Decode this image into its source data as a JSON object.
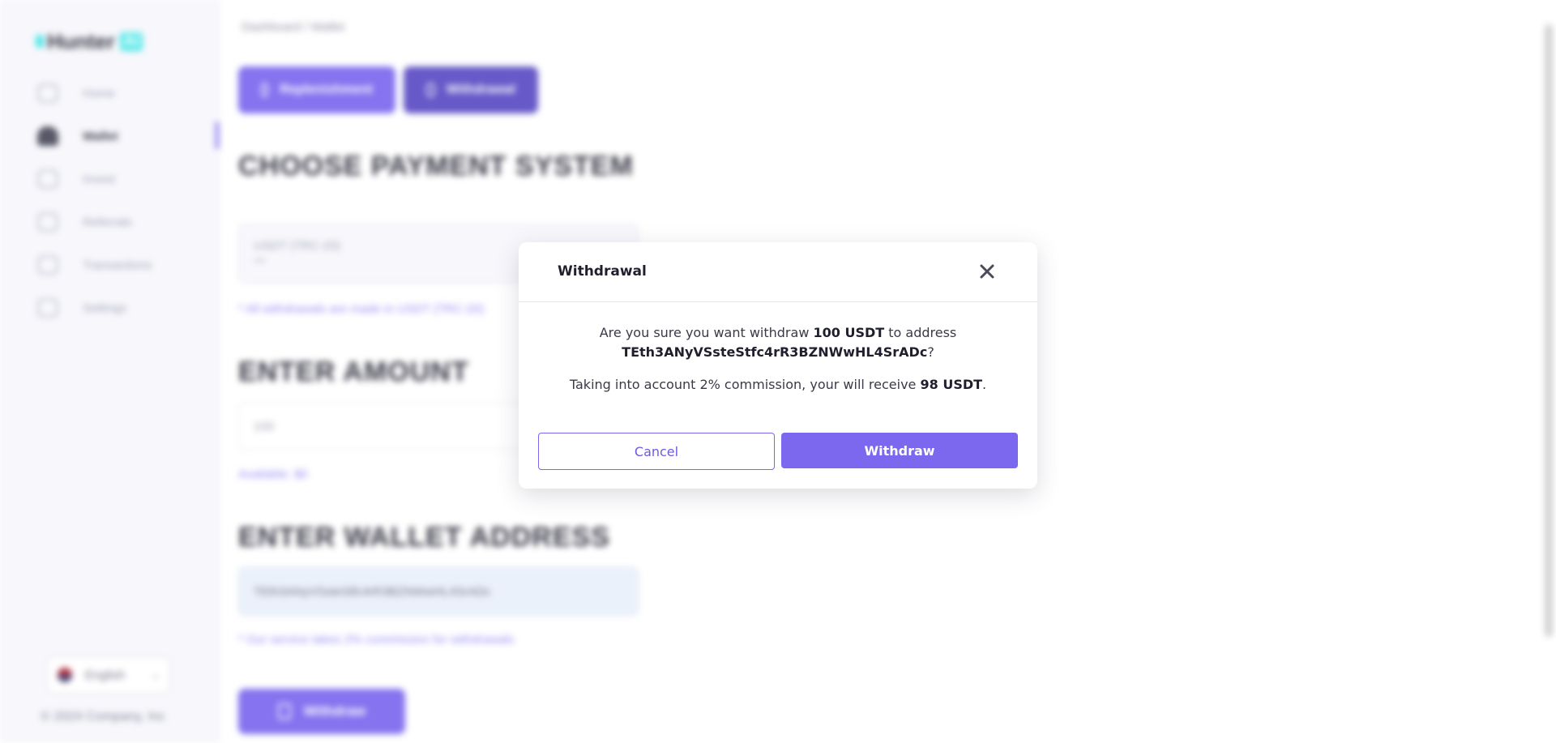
{
  "sidebar": {
    "logo": "Hunter",
    "logo_badge": "AI",
    "items": [
      {
        "label": "Home",
        "icon": "home-icon"
      },
      {
        "label": "Wallet",
        "icon": "wallet-icon"
      },
      {
        "label": "Invest",
        "icon": "invest-icon"
      },
      {
        "label": "Referrals",
        "icon": "referrals-icon"
      },
      {
        "label": "Transactions",
        "icon": "transactions-icon"
      },
      {
        "label": "Settings",
        "icon": "settings-icon"
      }
    ],
    "active_item": "Wallet",
    "language": "English",
    "copyright": "© 2024 Company, Inc"
  },
  "main": {
    "breadcrumb": "Dashboard / Wallet",
    "tabs": [
      {
        "label": "Replenishment"
      },
      {
        "label": "Withdrawal"
      }
    ],
    "payment_title": "CHOOSE PAYMENT SYSTEM",
    "payment_selected": "USDT (TRC-20)",
    "payment_sub": "***",
    "payment_hint": "* All withdrawals are made in USDT (TRC-20)",
    "amount_title": "ENTER AMOUNT",
    "amount_value": "100",
    "available_label": "Available:",
    "available_value": "$0",
    "wallet_title": "ENTER WALLET ADDRESS",
    "wallet_value": "TEth3ANyVSsteStfc4rR3BZNWwHL4SrADc",
    "commission_hint": "* Our service takes 2% commission for withdrawals",
    "withdraw_button": "Withdraw"
  },
  "modal": {
    "title": "Withdrawal",
    "line1_prefix": "Are you sure you want withdraw ",
    "amount": "100 USDT",
    "line1_suffix": " to address",
    "address": "TEth3ANyVSsteStfc4rR3BZNWwHL4SrADc",
    "address_suffix": "?",
    "line2_prefix": "Taking into account 2% commission, your will receive ",
    "receive": "98 USDT",
    "line2_suffix": ".",
    "cancel_label": "Cancel",
    "confirm_label": "Withdraw"
  },
  "colors": {
    "accent": "#7b68ee",
    "accent_dark": "#5b4bc4",
    "logo_accent": "#45e6e6"
  }
}
